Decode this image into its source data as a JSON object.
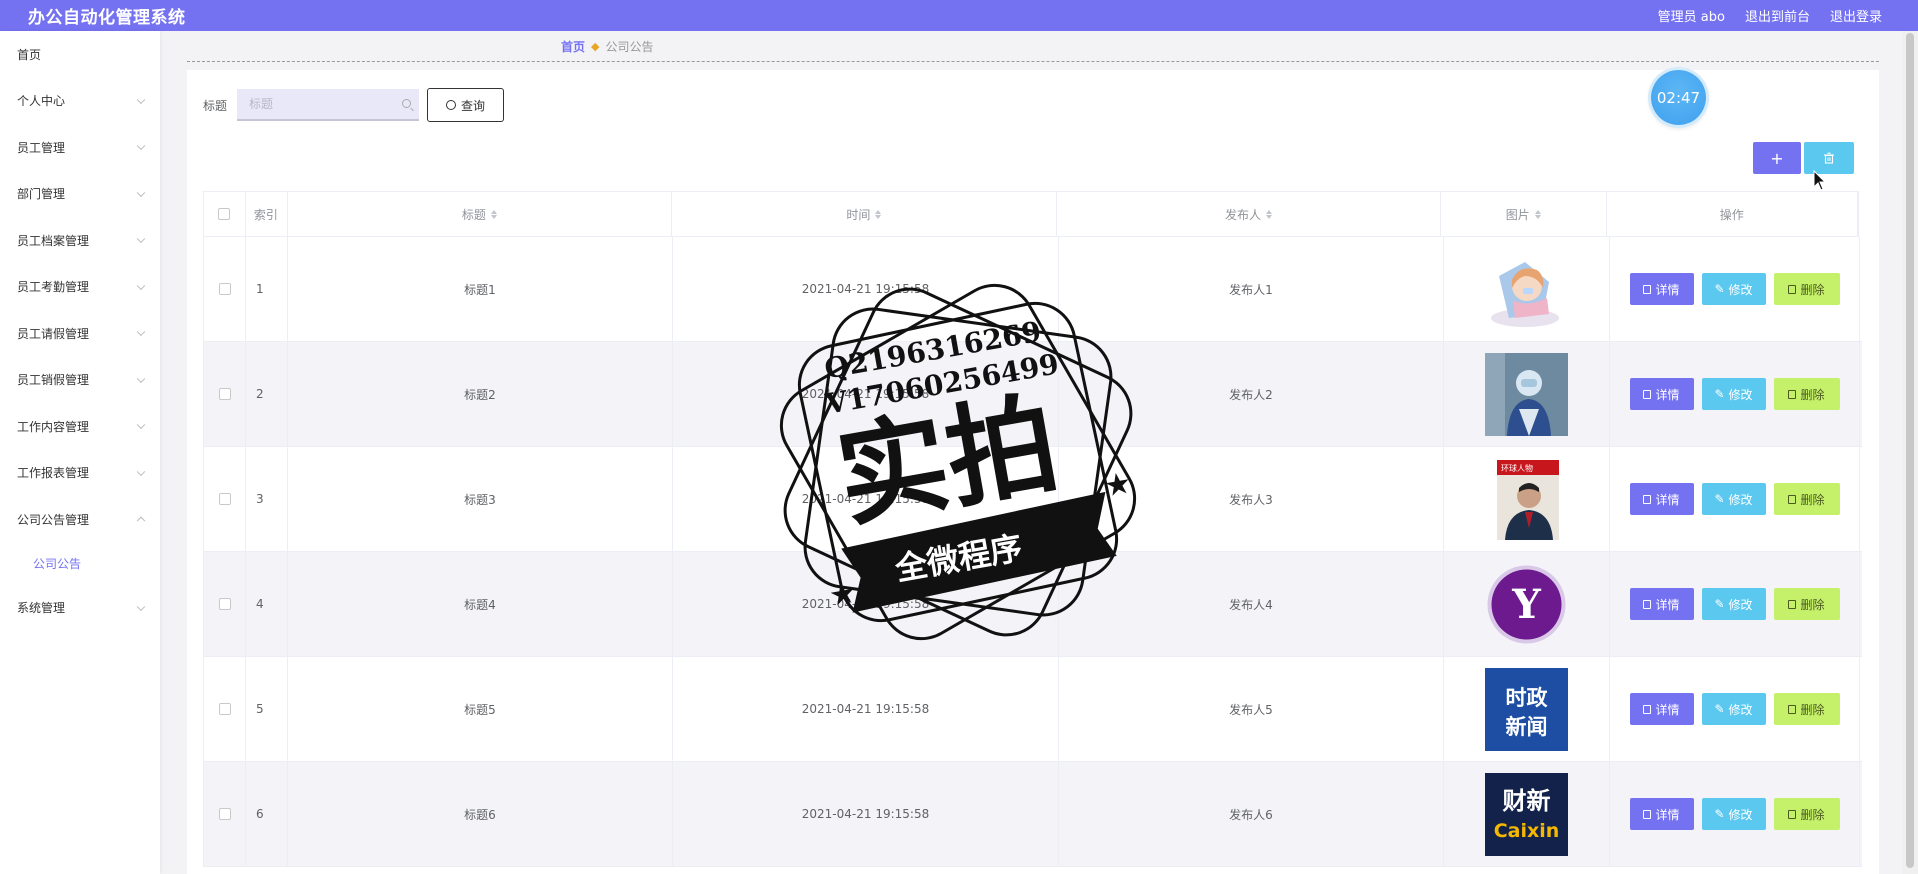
{
  "header": {
    "app_title": "办公自动化管理系统",
    "user_label": "管理员 abo",
    "frontend_link": "退出到前台",
    "logout_link": "退出登录"
  },
  "sidebar": {
    "items": [
      {
        "label": "首页"
      },
      {
        "label": "个人中心"
      },
      {
        "label": "员工管理"
      },
      {
        "label": "部门管理"
      },
      {
        "label": "员工档案管理"
      },
      {
        "label": "员工考勤管理"
      },
      {
        "label": "员工请假管理"
      },
      {
        "label": "员工销假管理"
      },
      {
        "label": "工作内容管理"
      },
      {
        "label": "工作报表管理"
      },
      {
        "label": "公司公告管理"
      },
      {
        "label": "系统管理"
      }
    ],
    "submenu_active": "公司公告"
  },
  "breadcrumb": {
    "home": "首页",
    "current": "公司公告"
  },
  "search": {
    "label": "标题",
    "placeholder": "标题",
    "button_label": "查询"
  },
  "timer": "02:47",
  "actions": {
    "add_label": "+"
  },
  "table": {
    "columns": [
      "索引",
      "标题",
      "时间",
      "发布人",
      "图片",
      "操作"
    ],
    "rows": [
      {
        "index": "1",
        "title": "标题1",
        "time": "2021-04-21 19:15:58",
        "publisher": "发布人1",
        "image": "cartoon-girl"
      },
      {
        "index": "2",
        "title": "标题2",
        "time": "2021-04-21 19:15:58",
        "publisher": "发布人2",
        "image": "medical-worker"
      },
      {
        "index": "3",
        "title": "标题3",
        "time": "2021-04-21 19:15:58",
        "publisher": "发布人3",
        "image": "magazine-cover"
      },
      {
        "index": "4",
        "title": "标题4",
        "time": "2021-04-21 19:15:58",
        "publisher": "发布人4",
        "image": "yahoo-logo"
      },
      {
        "index": "5",
        "title": "标题5",
        "time": "2021-04-21 19:15:58",
        "publisher": "发布人5",
        "image": "news-logo"
      },
      {
        "index": "6",
        "title": "标题6",
        "time": "2021-04-21 19:15:58",
        "publisher": "发布人6",
        "image": "caixin-logo"
      }
    ],
    "op_labels": {
      "detail": "详情",
      "edit": "修改",
      "delete": "删除"
    }
  },
  "images": {
    "news_line1": "时政",
    "news_line2": "新闻",
    "caixin_cn": "财新",
    "caixin_en": "Caixin",
    "yahoo": "Y",
    "magazine": "环球人物"
  },
  "watermark": {
    "line1": "Q2196316269",
    "line2": "V17060256499",
    "big": "实拍",
    "banner": "全微程序"
  },
  "colors": {
    "primary": "#7572f2",
    "info": "#5bc8f0",
    "danger_soft": "#c5f06a"
  }
}
